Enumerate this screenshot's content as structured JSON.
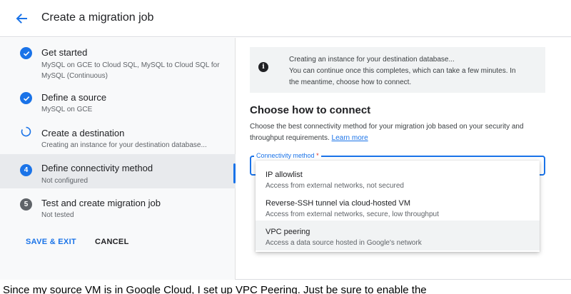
{
  "header": {
    "title": "Create a migration job"
  },
  "steps": [
    {
      "state": "done",
      "number": "",
      "label": "Get started",
      "sub": "MySQL on GCE to Cloud SQL, MySQL to Cloud SQL for MySQL (Continuous)"
    },
    {
      "state": "done",
      "number": "",
      "label": "Define a source",
      "sub": "MySQL on GCE"
    },
    {
      "state": "in-progress",
      "number": "",
      "label": "Create a destination",
      "sub": "Creating an instance for your destination database..."
    },
    {
      "state": "active",
      "number": "4",
      "label": "Define connectivity method",
      "sub": "Not configured"
    },
    {
      "state": "pending",
      "number": "5",
      "label": "Test and create migration job",
      "sub": "Not tested"
    }
  ],
  "actions": {
    "save_label": "SAVE & EXIT",
    "cancel_label": "CANCEL"
  },
  "info": {
    "icon": "info-icon",
    "line1": "Creating an instance for your destination database...",
    "line2": "You can continue once this completes, which can take a few minutes. In",
    "line3": "the meantime, choose how to connect."
  },
  "connect": {
    "title": "Choose how to connect",
    "desc": "Choose the best connectivity method for your migration job based on your security and throughput requirements.",
    "learn_more": "Learn more",
    "field_label": "Connectivity method",
    "required_mark": "*"
  },
  "options": [
    {
      "title": "IP allowlist",
      "desc": "Access from external networks, not secured"
    },
    {
      "title": "Reverse-SSH tunnel via cloud-hosted VM",
      "desc": "Access from external networks, secure, low throughput"
    },
    {
      "title": "VPC peering",
      "desc": "Access a data source hosted in Google's network"
    }
  ],
  "caption": "Since my source VM is in Google Cloud, I set up VPC Peering. Just be sure to enable the",
  "colors": {
    "accent": "#1a73e8",
    "pending": "#5f6368",
    "sidebar_bg": "#f8f9fa",
    "active_bg": "#e8eaed"
  }
}
